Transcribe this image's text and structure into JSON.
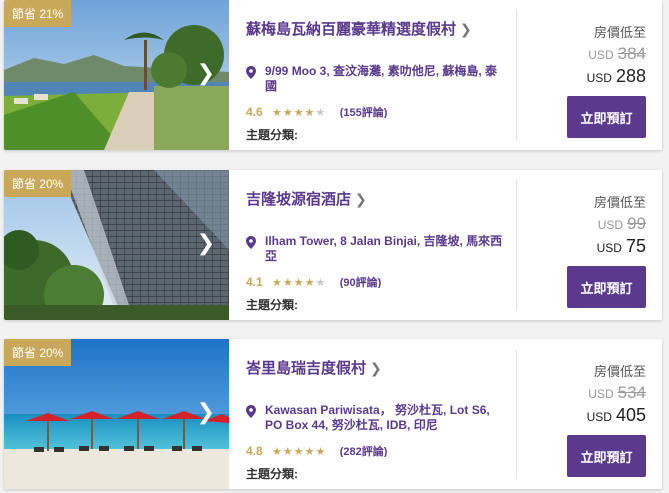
{
  "colors": {
    "brand_purple": "#5b3a8e",
    "gold": "#c9a85a"
  },
  "hotels": [
    {
      "badge": "節省 21%",
      "name": "蘇梅島瓦納百麗豪華精選度假村",
      "address": "9/99 Moo 3, 查汶海灘, 素叻他尼, 蘇梅島, 泰國",
      "score": "4.6",
      "stars": 4.5,
      "stars_full": "★★★★",
      "stars_half": "★",
      "stars_empty": "",
      "reviews": "(155評論)",
      "theme_label": "主題分類:",
      "price_label": "房價低至",
      "currency": "USD",
      "old_price": "384",
      "new_price": "288",
      "book_label": "立即預訂",
      "image": "beach-resort-lawn-photo"
    },
    {
      "badge": "節省 20%",
      "name": "吉隆坡源宿酒店",
      "address": "Ilham Tower, 8 Jalan Binjai, 吉隆坡, 馬來西亞",
      "score": "4.1",
      "stars": 4,
      "stars_full": "★★★★",
      "stars_half": "",
      "stars_empty": "★",
      "reviews": "(90評論)",
      "theme_label": "主題分類:",
      "price_label": "房價低至",
      "currency": "USD",
      "old_price": "99",
      "new_price": "75",
      "book_label": "立即預訂",
      "image": "glass-tower-photo"
    },
    {
      "badge": "節省 20%",
      "name": "峇里島瑞吉度假村",
      "address": "Kawasan Pariwisata， 努沙杜瓦, Lot S6, PO Box 44, 努沙杜瓦, IDB, 印尼",
      "score": "4.8",
      "stars": 5,
      "stars_full": "★★★★★",
      "stars_half": "",
      "stars_empty": "",
      "reviews": "(282評論)",
      "theme_label": "主題分類:",
      "price_label": "房價低至",
      "currency": "USD",
      "old_price": "534",
      "new_price": "405",
      "book_label": "立即預訂",
      "image": "red-umbrella-beach-photo"
    }
  ]
}
